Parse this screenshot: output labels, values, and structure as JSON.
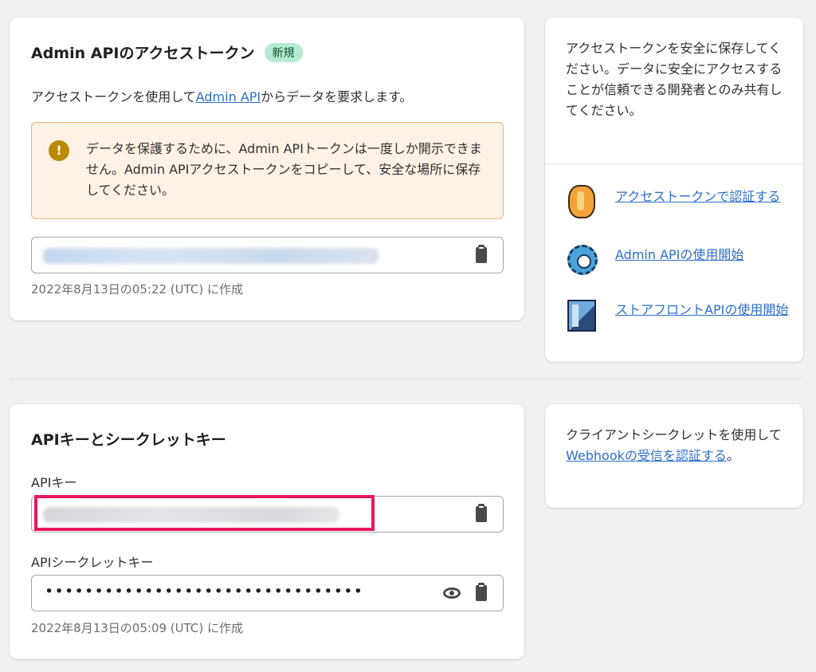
{
  "access_token": {
    "title": "Admin APIのアクセストークン",
    "badge": "新規",
    "description_prefix": "アクセストークンを使用して",
    "description_link": "Admin API",
    "description_suffix": "からデータを要求します。",
    "warning_text": "データを保護するために、Admin APIトークンは一度しか開示できません。Admin APIアクセストークンをコピーして、安全な場所に保存してください。",
    "created_caption": "2022年8月13日の05:22 (UTC) に作成"
  },
  "side_access": {
    "text": "アクセストークンを安全に保存してください。データに安全にアクセスすることが信頼できる開発者とのみ共有してください。",
    "resources": [
      {
        "label": "アクセストークンで認証する",
        "icon": "coin-icon"
      },
      {
        "label": "Admin APIの使用開始",
        "icon": "gear-icon"
      },
      {
        "label": "ストアフロントAPIの使用開始",
        "icon": "storefront-book-icon"
      }
    ]
  },
  "api_keys": {
    "title": "APIキーとシークレットキー",
    "api_key_label": "APIキー",
    "secret_label": "APIシークレットキー",
    "secret_value": "••••••••••••••••••••••••••••••••",
    "created_caption": "2022年8月13日の05:09 (UTC) に作成"
  },
  "side_webhook": {
    "text_prefix": "クライアントシークレットを使用して",
    "link": "Webhookの受信を認証する",
    "text_suffix": "。"
  },
  "colors": {
    "link": "#2c6ecb",
    "badge_bg": "#b4ebd2",
    "warning_bg": "#fef1e5",
    "warning_icon": "#b98900",
    "highlight": "#e8175d"
  }
}
